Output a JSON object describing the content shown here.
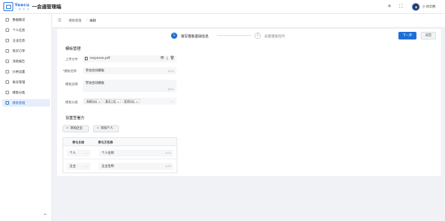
{
  "header": {
    "brand": "Yeecu",
    "brand_sub": "一 起 会 议",
    "app_title": "一会通管理端",
    "icons": [
      "sun-icon",
      "fullscreen-icon",
      "avatar"
    ],
    "username": "小 的印费"
  },
  "sidebar": {
    "items": [
      {
        "label": "数据概况",
        "icon": "dashboard-icon",
        "active": false
      },
      {
        "label": "个人信息",
        "icon": "user-icon",
        "active": false
      },
      {
        "label": "企业信息",
        "icon": "company-icon",
        "active": false
      },
      {
        "label": "购买订单",
        "icon": "order-icon",
        "active": false
      },
      {
        "label": "消耗报告",
        "icon": "report-icon",
        "active": false
      },
      {
        "label": "价格设置",
        "icon": "price-icon",
        "active": false
      },
      {
        "label": "账号管理",
        "icon": "account-icon",
        "active": false
      },
      {
        "label": "模板分类",
        "icon": "category-icon",
        "active": false
      },
      {
        "label": "模板管理",
        "icon": "template-icon",
        "active": true
      }
    ],
    "collapse_icon": "collapse-icon"
  },
  "breadcrumb": {
    "menu_icon": "menu-icon",
    "items": [
      "模板管理",
      "编辑"
    ],
    "separator": "/"
  },
  "steps": [
    {
      "num": "1",
      "label": "填写模板基础信息",
      "active": true
    },
    {
      "num": "2",
      "label": "设置模板控件",
      "active": false
    }
  ],
  "actions": {
    "next": "下一步",
    "back": "返回"
  },
  "form": {
    "section_title": "模板管理",
    "upload_label": "上传文件",
    "file_name": "response.pdf",
    "name_label": "模板名称",
    "name_value": "劳动合同模板",
    "name_count": "6/15",
    "desc_label": "模板说明",
    "desc_value": "劳动合同模板",
    "desc_count": "6/50",
    "category_label": "模板分类",
    "category_tags": [
      "和解协议",
      "建设工程",
      "租赁协议"
    ]
  },
  "parties": {
    "section_title": "设置签署方",
    "add_company": "添加企业",
    "add_person": "添加个人",
    "columns": [
      "参与主体",
      "参与方名称"
    ],
    "rows": [
      {
        "type": "个人",
        "name": "个人名称",
        "count": "4/15"
      },
      {
        "type": "企业",
        "name": "企业名称",
        "count": "4/15"
      }
    ]
  }
}
